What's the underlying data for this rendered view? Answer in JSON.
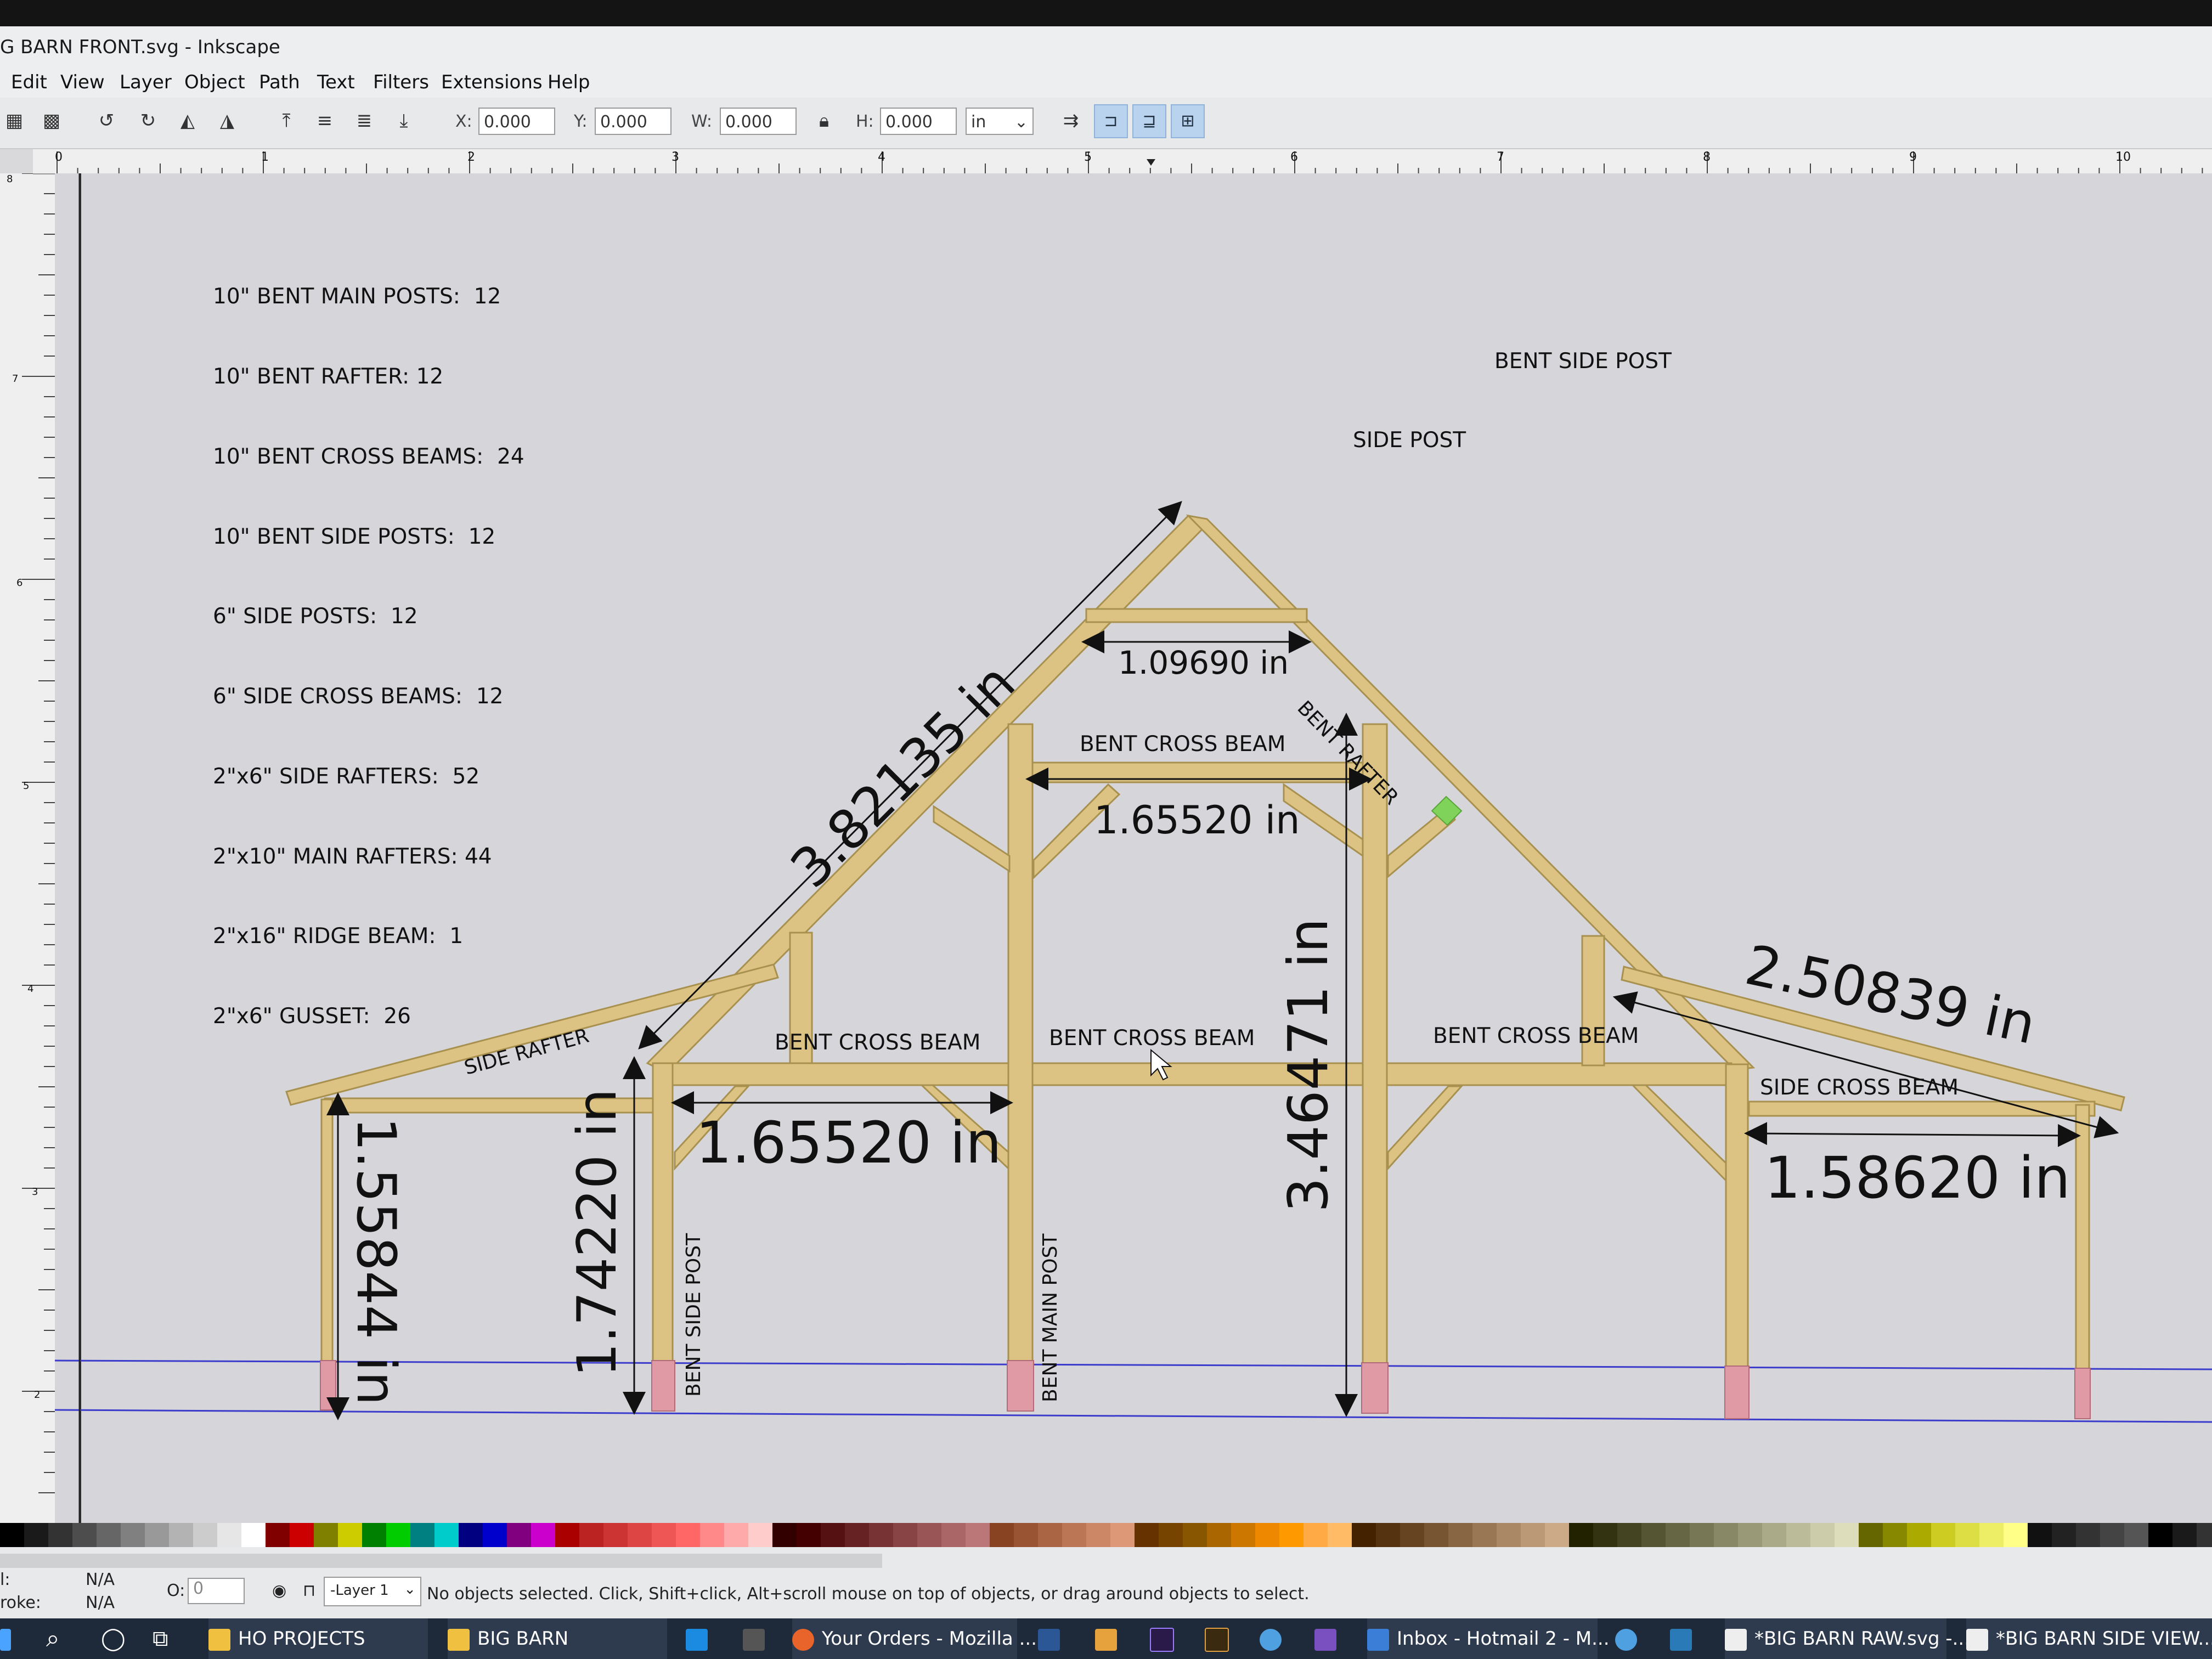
{
  "window": {
    "title": "G BARN FRONT.svg - Inkscape"
  },
  "menu": [
    "Edit",
    "View",
    "Layer",
    "Object",
    "Path",
    "Text",
    "Filters",
    "Extensions",
    "Help"
  ],
  "toolbar": {
    "x_label": "X:",
    "x_value": "0.000",
    "y_label": "Y:",
    "y_value": "0.000",
    "w_label": "W:",
    "w_value": "0.000",
    "h_label": "H:",
    "h_value": "0.000",
    "unit": "in"
  },
  "ruler": {
    "h_ticks": [
      "0",
      "1",
      "2",
      "3",
      "4",
      "5",
      "6",
      "7",
      "8",
      "9",
      "10"
    ],
    "v_ticks": [
      "8",
      "7",
      "6",
      "5",
      "4",
      "3",
      "2"
    ]
  },
  "parts_list": [
    "10\" BENT MAIN POSTS:  12",
    "10\" BENT RAFTER: 12",
    "10\" BENT CROSS BEAMS:  24",
    "10\" BENT SIDE POSTS:  12",
    "6\" SIDE POSTS:  12",
    "6\" SIDE CROSS BEAMS:  12",
    "2\"x6\" SIDE RAFTERS:  52",
    "2\"x10\" MAIN RAFTERS: 44",
    "2\"x16\" RIDGE BEAM:  1",
    "2\"x6\" GUSSET:  26"
  ],
  "drawing_labels": {
    "bent_side_post_top": "BENT SIDE POST",
    "side_post_top": "SIDE POST",
    "bent_rafter": "BENT RAFTER",
    "side_rafter": "SIDE RAFTER",
    "bent_cross_beam_upper": "BENT CROSS BEAM",
    "bent_cross_beam_left": "BENT CROSS BEAM",
    "bent_cross_beam_center": "BENT CROSS BEAM",
    "bent_cross_beam_right": "BENT CROSS BEAM",
    "side_cross_beam": "SIDE CROSS BEAM",
    "bent_side_post_vertical": "BENT SIDE POST",
    "bent_main_post_vertical": "BENT MAIN POST"
  },
  "dimensions": {
    "rafter_length": "3.82135 in",
    "top_beam": "1.09690 in",
    "upper_cross": "1.65520 in",
    "main_height": "3.46471 in",
    "right_rafter": "2.50839 in",
    "lower_cross": "1.65520 in",
    "side_cross": "1.58620 in",
    "side_post_height": "1.55844 in",
    "bent_side_height": "1.74220 in"
  },
  "colors": {
    "timber": "#dcc384",
    "timber_edge": "#a8904f",
    "footing": "#e09aa6",
    "guide": "#3b3bcc",
    "gusset": "#7fd35a"
  },
  "status": {
    "fill_label": "l:",
    "fill_value": "N/A",
    "stroke_label": "roke:",
    "stroke_value": "N/A",
    "opacity_label": "O:",
    "opacity_value": "0",
    "layer": "-Layer 1",
    "message": "No objects selected. Click, Shift+click, Alt+scroll mouse on top of objects, or drag around objects to select."
  },
  "taskbar": {
    "items": [
      "HO PROJECTS",
      "BIG BARN",
      "Your Orders - Mozilla ...",
      "Inbox - Hotmail 2 - M...",
      "*BIG BARN RAW.svg -...",
      "*BIG BARN SIDE VIEW..."
    ]
  }
}
